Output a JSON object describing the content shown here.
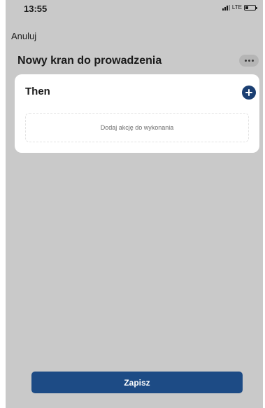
{
  "status_bar": {
    "time": "13:55",
    "network": "LTE",
    "icons": [
      "signal-icon",
      "battery-icon"
    ]
  },
  "header": {
    "cancel_label": "Anuluj",
    "title": "Nowy kran do prowadzenia",
    "more_icon": "more-horizontal-icon"
  },
  "then_card": {
    "title": "Then",
    "add_icon": "plus-circle-icon",
    "placeholder": "Dodaj akcję do wykonania"
  },
  "footer": {
    "save_label": "Zapisz"
  },
  "colors": {
    "screen_background": "#c9c9c9",
    "card_background": "#ffffff",
    "accent": "#1d4b85",
    "add_icon": "#1b3f72"
  }
}
